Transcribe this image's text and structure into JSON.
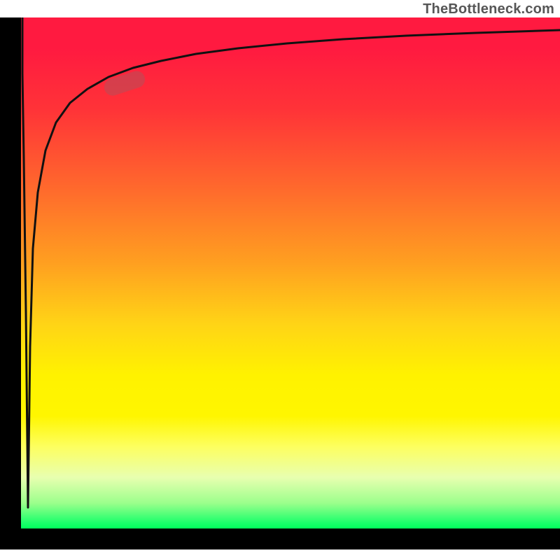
{
  "watermark": "TheBottleneck.com",
  "colors": {
    "frame": "#000000",
    "curve": "#1a1a1a",
    "pill": "rgba(180,80,90,0.55)",
    "gradient_top": "#ff1a40",
    "gradient_mid": "#fff200",
    "gradient_bottom": "#00ff5a"
  },
  "chart_data": {
    "type": "line",
    "title": "",
    "xlabel": "",
    "ylabel": "",
    "xlim": [
      0,
      100
    ],
    "ylim": [
      0,
      100
    ],
    "annotations": [
      {
        "kind": "watermark",
        "text": "TheBottleneck.com",
        "position": "top-right"
      },
      {
        "kind": "highlight-pill",
        "x_center": 19,
        "y_center": 85
      }
    ],
    "series": [
      {
        "name": "curve",
        "x": [
          0,
          1,
          2,
          3,
          4,
          6,
          8,
          12,
          16,
          20,
          25,
          30,
          40,
          50,
          60,
          70,
          80,
          90,
          100
        ],
        "y": [
          100,
          4,
          35,
          55,
          65,
          74,
          79,
          84,
          86,
          88,
          90,
          91,
          92.5,
          93.5,
          94.3,
          95,
          95.6,
          96.1,
          96.5
        ]
      }
    ],
    "background": {
      "type": "vertical-gradient",
      "stops": [
        {
          "pos": 0.0,
          "color": "#ff1a40"
        },
        {
          "pos": 0.5,
          "color": "#ff9f20"
        },
        {
          "pos": 0.72,
          "color": "#fff200"
        },
        {
          "pos": 0.96,
          "color": "#9cff8c"
        },
        {
          "pos": 1.0,
          "color": "#00ff5a"
        }
      ]
    }
  }
}
